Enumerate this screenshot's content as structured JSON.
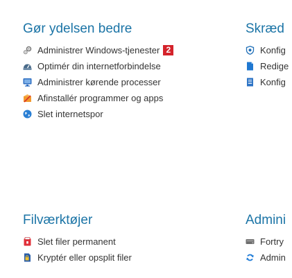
{
  "colors": {
    "heading": "#1b74a6",
    "text": "#333333",
    "badge_bg": "#d4232b"
  },
  "sections": {
    "performance": {
      "title": "Gør ydelsen bedre",
      "items": [
        {
          "label": "Administrer Windows-tjenester",
          "icon": "gears-icon",
          "badge": "2"
        },
        {
          "label": "Optimér din internetforbindelse",
          "icon": "speedometer-icon"
        },
        {
          "label": "Administrer kørende processer",
          "icon": "monitor-icon"
        },
        {
          "label": "Afinstallér programmer og apps",
          "icon": "uninstall-box-icon"
        },
        {
          "label": "Slet internetspor",
          "icon": "globe-icon"
        }
      ]
    },
    "customize": {
      "title": "Skræd",
      "items": [
        {
          "label": "Konfig",
          "icon": "shield-icon"
        },
        {
          "label": "Redige",
          "icon": "document-edit-icon"
        },
        {
          "label": "Konfig",
          "icon": "document-list-icon"
        }
      ]
    },
    "file_tools": {
      "title": "Filværktøjer",
      "items": [
        {
          "label": "Slet filer permanent",
          "icon": "shredder-icon"
        },
        {
          "label": "Kryptér eller opsplit filer",
          "icon": "encrypt-file-icon"
        }
      ]
    },
    "admin": {
      "title": "Admini",
      "items": [
        {
          "label": "Fortry",
          "icon": "drive-icon"
        },
        {
          "label": "Admin",
          "icon": "refresh-icon"
        }
      ]
    }
  }
}
